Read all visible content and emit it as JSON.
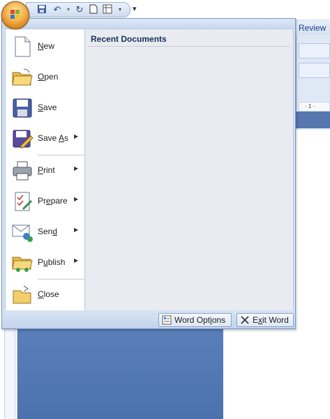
{
  "ribbon": {
    "tab_review": "Review",
    "ruler_mark": "· 1 ·"
  },
  "quick_access": {
    "items": [
      "save-icon",
      "undo-icon",
      "redo-icon",
      "new-doc-icon",
      "table-icon",
      "customize-icon"
    ]
  },
  "office_menu": {
    "items": [
      {
        "label_pre": "",
        "label_key": "N",
        "label_post": "ew",
        "icon": "new-document-icon",
        "submenu": false
      },
      {
        "label_pre": "",
        "label_key": "O",
        "label_post": "pen",
        "icon": "open-folder-icon",
        "submenu": false
      },
      {
        "label_pre": "",
        "label_key": "S",
        "label_post": "ave",
        "icon": "save-disk-icon",
        "submenu": false
      },
      {
        "label_pre": "Save ",
        "label_key": "A",
        "label_post": "s",
        "icon": "save-as-icon",
        "submenu": true
      },
      {
        "label_pre": "",
        "label_key": "P",
        "label_post": "rint",
        "icon": "printer-icon",
        "submenu": true
      },
      {
        "label_pre": "Pr",
        "label_key": "e",
        "label_post": "pare",
        "icon": "prepare-icon",
        "submenu": true
      },
      {
        "label_pre": "Sen",
        "label_key": "d",
        "label_post": "",
        "icon": "send-icon",
        "submenu": true
      },
      {
        "label_pre": "P",
        "label_key": "u",
        "label_post": "blish",
        "icon": "publish-icon",
        "submenu": true
      },
      {
        "label_pre": "",
        "label_key": "C",
        "label_post": "lose",
        "icon": "close-folder-icon",
        "submenu": false
      }
    ],
    "recent_documents_title": "Recent Documents",
    "word_options": {
      "pre": "Word Opt",
      "key": "i",
      "post": "ons"
    },
    "exit_word": {
      "pre": "E",
      "key": "x",
      "post": "it Word"
    }
  },
  "colors": {
    "menu_bg": "#d5e1f2",
    "title_blue": "#15315e",
    "doc_blue": "#4c72ad"
  }
}
